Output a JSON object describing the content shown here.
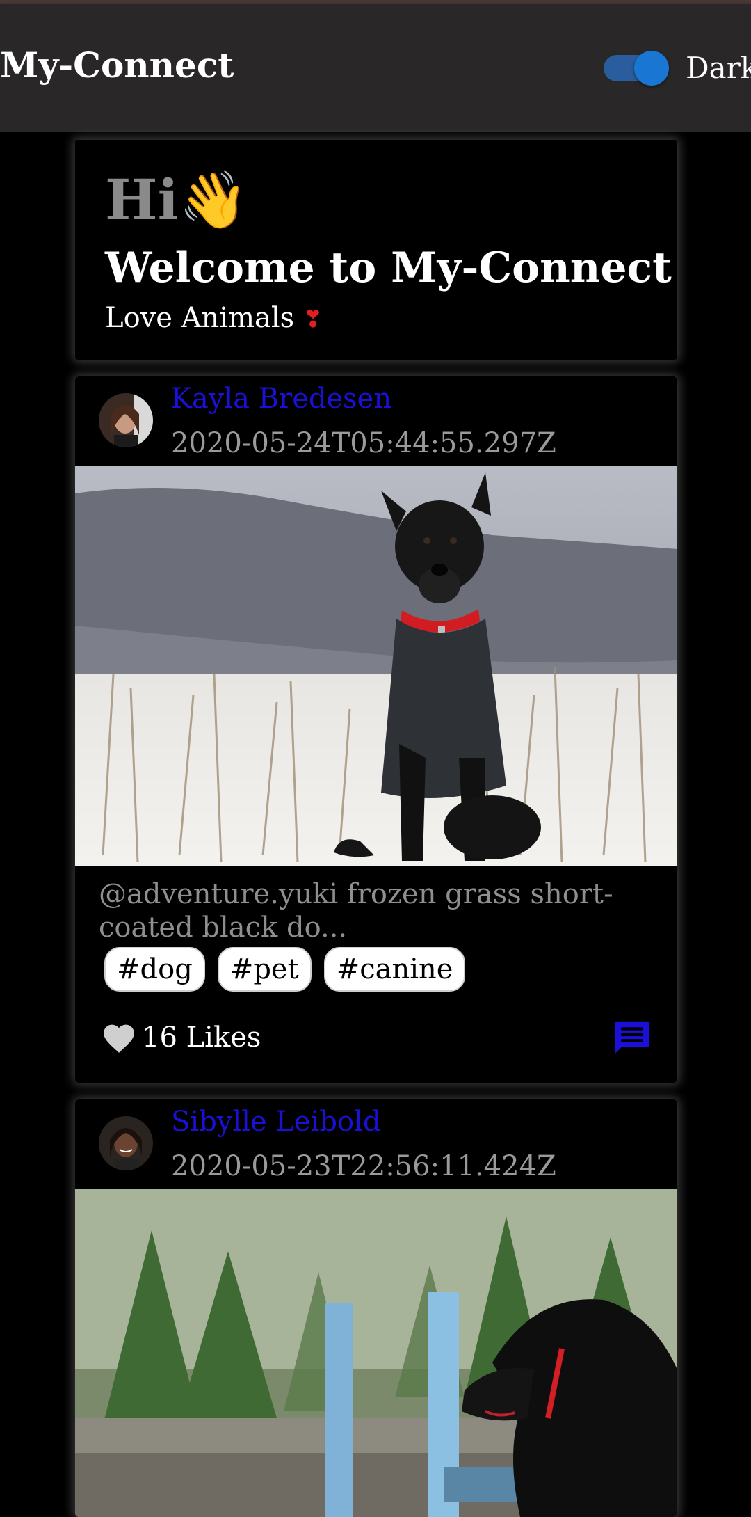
{
  "app": {
    "title": "My-Connect",
    "theme_toggle_label": "Dark",
    "theme_toggle_on": true
  },
  "welcome": {
    "hi": "Hi",
    "wave_emoji": "👋",
    "title": "Welcome to My-Connect",
    "subtitle": "Love Animals",
    "heart_emoji": "❣"
  },
  "posts": [
    {
      "author": "Kayla Bredesen",
      "timestamp": "2020-05-24T05:44:55.297Z",
      "image_icon": "dog-in-snow-photo",
      "caption": "@adventure.yuki frozen grass short-coated black do...",
      "tags": [
        "#dog",
        "#pet",
        "#canine"
      ],
      "likes": "16 Likes"
    },
    {
      "author": "Sibylle Leibold",
      "timestamp": "2020-05-23T22:56:11.424Z",
      "image_icon": "dog-in-forest-photo"
    }
  ],
  "colors": {
    "appbar": "#292727",
    "author_link": "#1a10d8",
    "toggle": "#1976d2",
    "comment_icon": "#1a10d8"
  }
}
